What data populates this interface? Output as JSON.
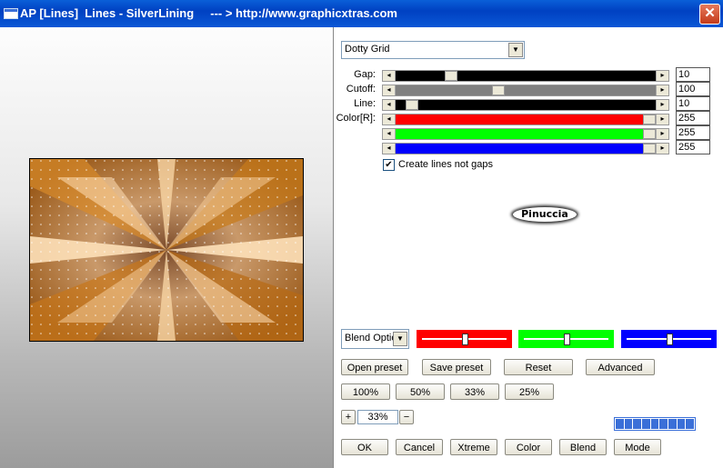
{
  "window": {
    "title": "AP [Lines]  Lines - SilverLining     --- > http://www.graphicxtras.com",
    "close": "✕"
  },
  "preset_dropdown": {
    "value": "Dotty Grid"
  },
  "sliders": [
    {
      "label": "Gap:",
      "value": "10",
      "color": "#000000",
      "fill": 0.2
    },
    {
      "label": "Cutoff:",
      "value": "100",
      "color": "#808080",
      "fill": 0.39
    },
    {
      "label": "Line:",
      "value": "10",
      "color": "#000000",
      "fill": 0.04
    },
    {
      "label": "Color[R]:",
      "value": "255",
      "color": "#ff0000",
      "fill": 1.0
    },
    {
      "label": "",
      "value": "255",
      "color": "#00ff00",
      "fill": 1.0
    },
    {
      "label": "",
      "value": "255",
      "color": "#0000ff",
      "fill": 1.0
    }
  ],
  "checkbox": {
    "label": "Create lines not gaps",
    "checked": "✔"
  },
  "logo": {
    "text": "Pinuccia"
  },
  "blend_dropdown": {
    "value": "Blend Optio"
  },
  "color_boxes": [
    {
      "name": "red",
      "color": "#ff0000",
      "level": 0.5
    },
    {
      "name": "green",
      "color": "#00ff00",
      "level": 0.5
    },
    {
      "name": "blue",
      "color": "#0000ff",
      "level": 0.5
    }
  ],
  "buttons_row1": {
    "open_preset": "Open preset",
    "save_preset": "Save preset",
    "reset": "Reset",
    "advanced": "Advanced"
  },
  "zoom_buttons": {
    "z100": "100%",
    "z50": "50%",
    "z33": "33%",
    "z25": "25%"
  },
  "zoom": {
    "plus": "+",
    "value": "33%",
    "minus": "−"
  },
  "bottom_buttons": {
    "ok": "OK",
    "cancel": "Cancel",
    "xtreme": "Xtreme",
    "color": "Color",
    "blend": "Blend",
    "mode": "Mode"
  }
}
